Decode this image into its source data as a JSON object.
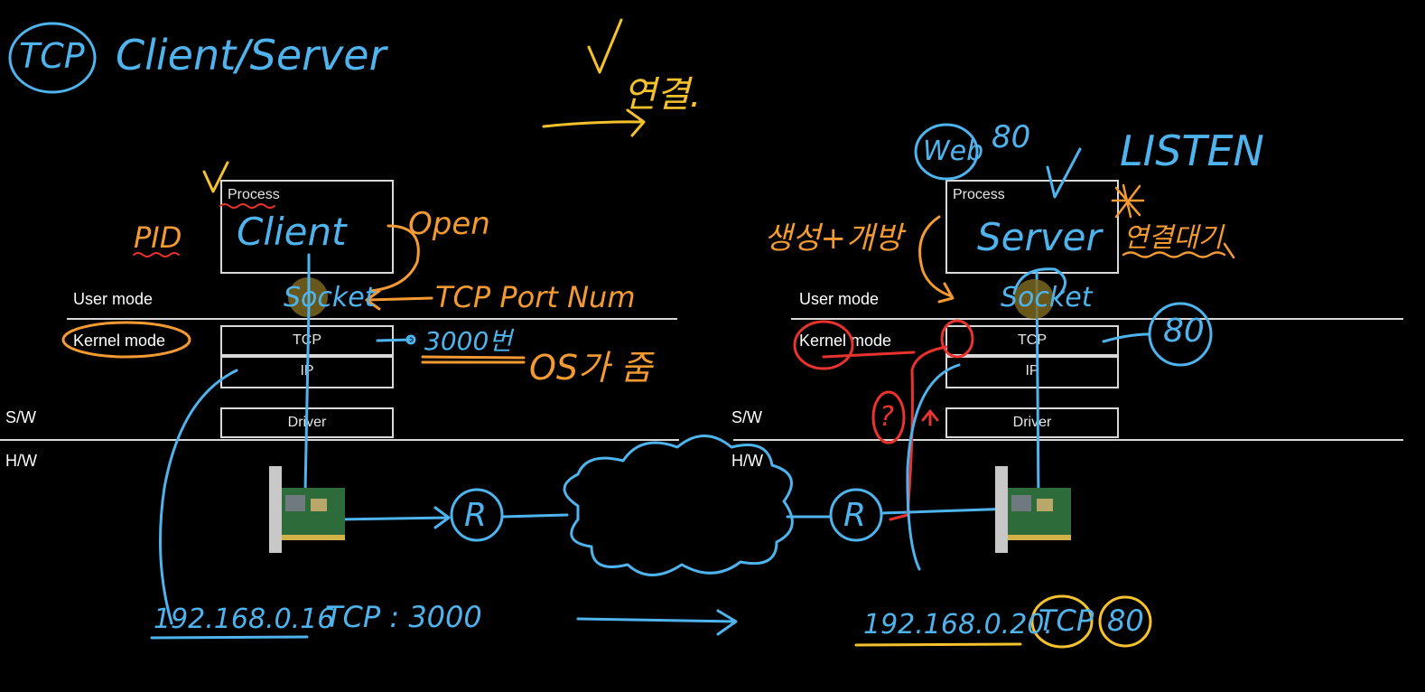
{
  "diagram": {
    "title": "Client/Server",
    "title_circle": "TCP",
    "connect_label": "연결.",
    "checkmark": "✓",
    "client": {
      "process_label": "Process",
      "process_name": "Client",
      "user_mode": "User mode",
      "kernel_mode": "Kernel mode",
      "tcp": "TCP",
      "ip": "IP",
      "driver": "Driver",
      "sw": "S/W",
      "hw": "H/W",
      "pid": "PID",
      "open": "Open",
      "socket": "Socket",
      "tcp_port_num": "TCP Port Num",
      "port": "3000번",
      "os_note": "OS가 줌",
      "address": "192.168.0.16",
      "tcp_addr": "TCP : 3000",
      "router": "R"
    },
    "server": {
      "process_label": "Process",
      "process_name": "Server",
      "user_mode": "User mode",
      "kernel_mode": "Kernel mode",
      "tcp": "TCP",
      "ip": "IP",
      "driver": "Driver",
      "sw": "S/W",
      "hw": "H/W",
      "web": "Web",
      "web_port": "80",
      "listen": "LISTEN",
      "wait": "연결대기",
      "create_open": "생성+개방",
      "socket": "Socket",
      "port_circle": "80",
      "question": "?",
      "address": "192.168.0.20.",
      "tcp_circle": "TCP",
      "port_addr": "80",
      "router": "R"
    }
  },
  "colors": {
    "background": "#000000",
    "box_line": "#d9d9d9",
    "blue": "#4fb4ee",
    "orange": "#f39a33",
    "yellow": "#f5c22e",
    "red": "#e8332f"
  }
}
